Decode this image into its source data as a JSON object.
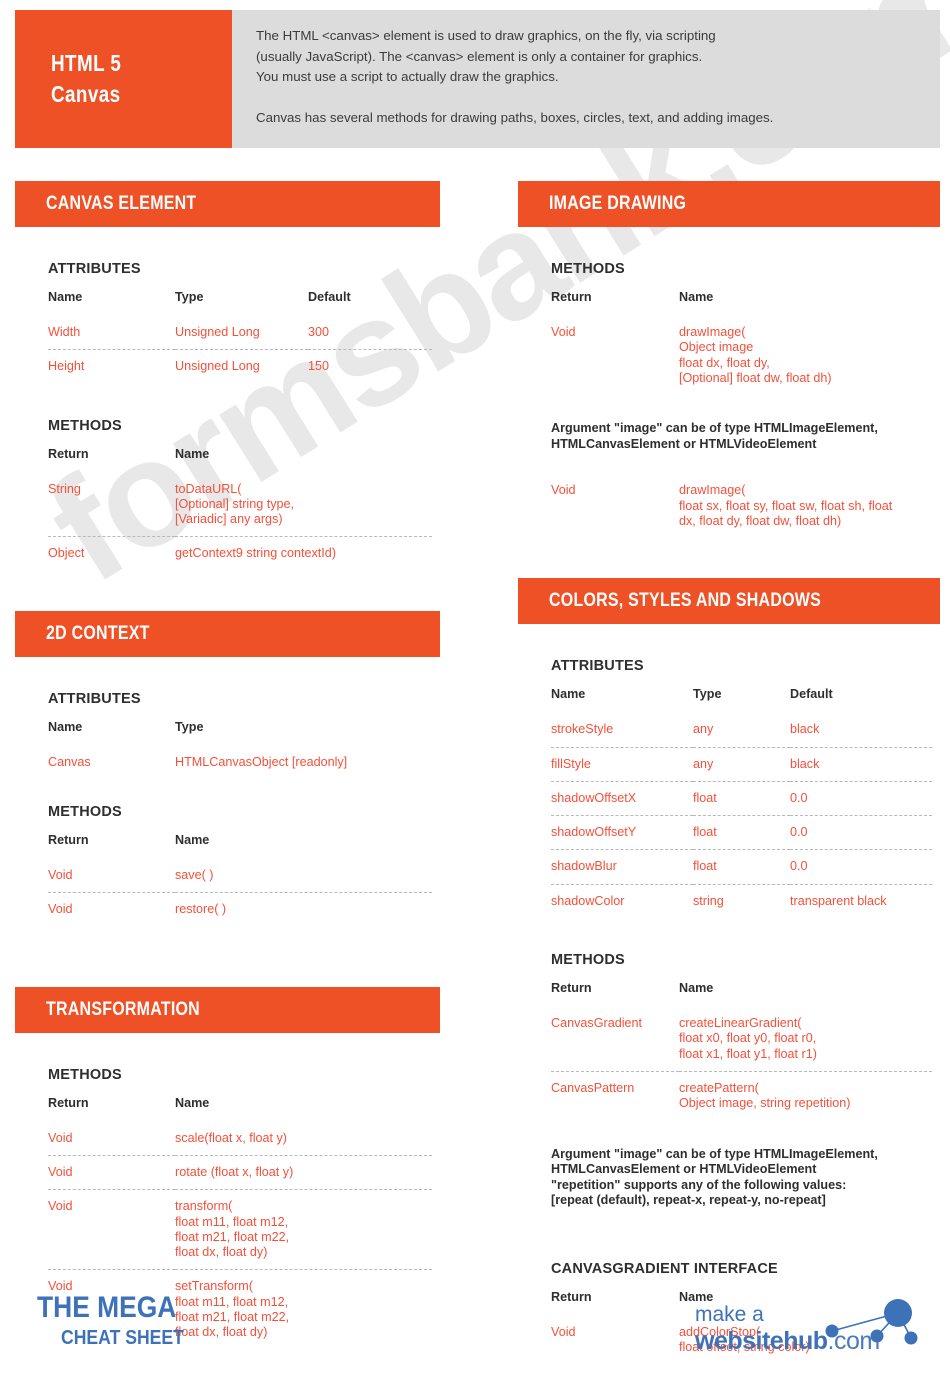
{
  "header": {
    "title_lines": [
      "HTML 5",
      "Canvas"
    ],
    "paragraphs": [
      "The HTML <canvas> element is used to draw graphics, on the fly, via scripting\n(usually JavaScript). The <canvas> element is only a container for graphics.\nYou must use a script to actually draw the graphics.",
      "Canvas has several methods for drawing paths, boxes, circles, text, and adding images."
    ]
  },
  "watermark": {
    "text": "formsbank.com"
  },
  "colors": {
    "accent_orange": "#ef5126",
    "body_red": "#f4503a",
    "header_gray": "#dcdcdc",
    "logo_blue": "#3d72b8",
    "heading_dark": "#2e2e2e",
    "dashed_rule": "#b9b9b9"
  },
  "left_column": {
    "sections": [
      {
        "title": "CANVAS ELEMENT",
        "groups": [
          {
            "label": "ATTRIBUTES",
            "headers": [
              "Name",
              "Type",
              "Default"
            ],
            "rows": [
              [
                "Width",
                "Unsigned Long",
                "300"
              ],
              [
                "Height",
                "Unsigned Long",
                "150"
              ]
            ]
          },
          {
            "label": "METHODS",
            "headers": [
              "Return",
              "Name"
            ],
            "rows": [
              [
                "String",
                "toDataURL(\n[Optional] string type,\n[Variadic] any args)"
              ],
              [
                "Object",
                "getContext9 string contextId)"
              ]
            ]
          }
        ]
      },
      {
        "title": "2D CONTEXT",
        "groups": [
          {
            "label": "ATTRIBUTES",
            "headers": [
              "Name",
              "Type"
            ],
            "rows": [
              [
                "Canvas",
                "HTMLCanvasObject [readonly]"
              ]
            ]
          },
          {
            "label": "METHODS",
            "headers": [
              "Return",
              "Name"
            ],
            "rows": [
              [
                "Void",
                "save( )"
              ],
              [
                "Void",
                "restore( )"
              ]
            ]
          }
        ]
      },
      {
        "title": "TRANSFORMATION",
        "groups": [
          {
            "label": "METHODS",
            "headers": [
              "Return",
              "Name"
            ],
            "rows": [
              [
                "Void",
                "scale(float x, float y)"
              ],
              [
                "Void",
                "rotate (float x, float y)"
              ],
              [
                "Void",
                "transform(\nfloat m11, float m12,\nfloat m21, float m22,\nfloat dx, float dy)"
              ],
              [
                "Void",
                "setTransform(\nfloat m11, float m12,\nfloat m21, float m22,\nfloat dx, float dy)"
              ]
            ]
          }
        ]
      }
    ]
  },
  "right_column": {
    "sections": [
      {
        "title": "IMAGE DRAWING",
        "groups": [
          {
            "label": "METHODS",
            "headers": [
              "Return",
              "Name"
            ],
            "rows": [
              [
                "Void",
                "drawImage(\nObject image\nfloat dx, float dy,\n[Optional] float dw, float dh)"
              ]
            ]
          }
        ],
        "note_after": "Argument \"image\" can be of type HTMLImageElement,\nHTMLCanvasElement or HTMLVideoElement",
        "groups_after": [
          {
            "headers": null,
            "rows": [
              [
                "Void",
                "drawImage(\nfloat sx, float sy, float sw, float sh, float\ndx, float dy, float dw, float dh)"
              ]
            ]
          }
        ]
      },
      {
        "title": "COLORS, STYLES AND SHADOWS",
        "groups": [
          {
            "label": "ATTRIBUTES",
            "headers": [
              "Name",
              "Type",
              "Default"
            ],
            "rows": [
              [
                "strokeStyle",
                "any",
                "black"
              ],
              [
                "fillStyle",
                "any",
                "black"
              ],
              [
                "shadowOffsetX",
                "float",
                "0.0"
              ],
              [
                "shadowOffsetY",
                "float",
                "0.0"
              ],
              [
                "shadowBlur",
                "float",
                "0.0"
              ],
              [
                "shadowColor",
                "string",
                "transparent black"
              ]
            ]
          },
          {
            "label": "METHODS",
            "headers": [
              "Return",
              "Name"
            ],
            "rows": [
              [
                "CanvasGradient",
                "createLinearGradient(\nfloat x0, float y0, float r0,\nfloat x1, float y1, float r1)"
              ],
              [
                "CanvasPattern",
                "createPattern(\nObject image, string repetition)"
              ]
            ]
          }
        ],
        "note_after": "Argument \"image\" can be of type HTMLImageElement,\nHTMLCanvasElement or HTMLVideoElement\n\"repetition\" supports any of the following values:\n[repeat (default), repeat-x, repeat-y, no-repeat]",
        "groups_after": [
          {
            "label": "CANVASGRADIENT INTERFACE",
            "headers": [
              "Return",
              "Name"
            ],
            "rows": [
              [
                "Void",
                "addColorStop(\nfloat offset, string color)"
              ]
            ]
          }
        ]
      }
    ]
  },
  "footer": {
    "mega_line1": "THE MEGA",
    "mega_line2": "CHEAT SHEET",
    "brand_line1": "make a",
    "brand_line2_bold": "websitehub",
    "brand_line2_rest": ".com"
  }
}
